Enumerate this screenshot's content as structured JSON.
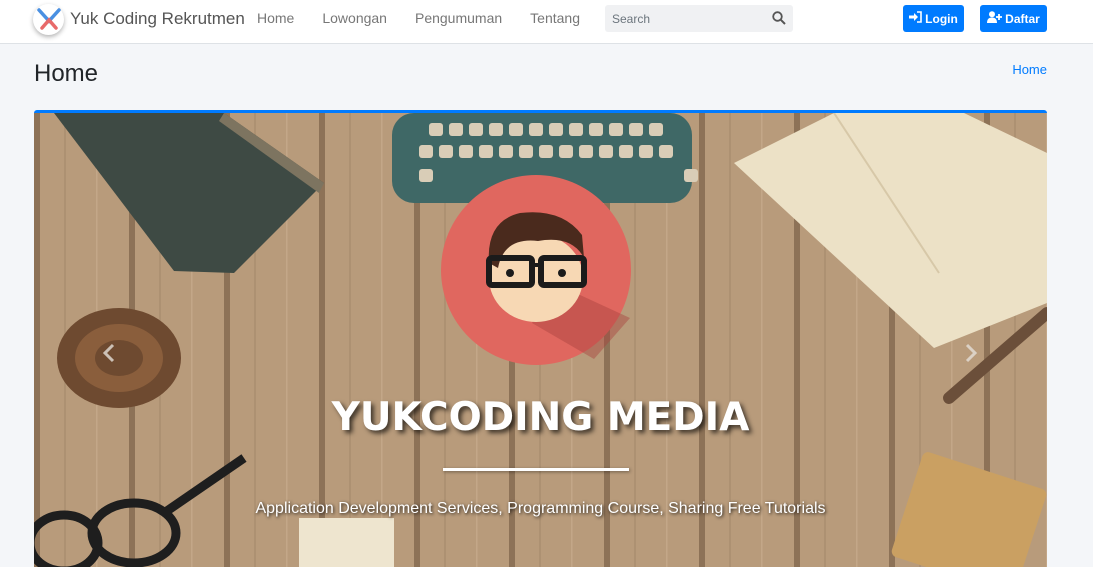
{
  "brand": {
    "name": "Yuk Coding Rekrutmen",
    "logo_icon": "yc-logo-icon"
  },
  "nav": {
    "items": [
      {
        "label": "Home"
      },
      {
        "label": "Lowongan"
      },
      {
        "label": "Pengumuman"
      },
      {
        "label": "Tentang"
      }
    ]
  },
  "search": {
    "placeholder": "Search",
    "icon": "search-icon"
  },
  "auth": {
    "login_label": "Login",
    "daftar_label": "Daftar",
    "login_icon": "sign-in-icon",
    "daftar_icon": "user-plus-icon"
  },
  "content_header": {
    "title": "Home",
    "breadcrumb": "Home"
  },
  "hero": {
    "title": "YUKCODING MEDIA",
    "subtitle": "Application Development Services, Programming Course, Sharing Free Tutorials",
    "avatar_bg": "#e0675f"
  },
  "colors": {
    "primary": "#007bff",
    "page_bg": "#f4f6f9"
  }
}
